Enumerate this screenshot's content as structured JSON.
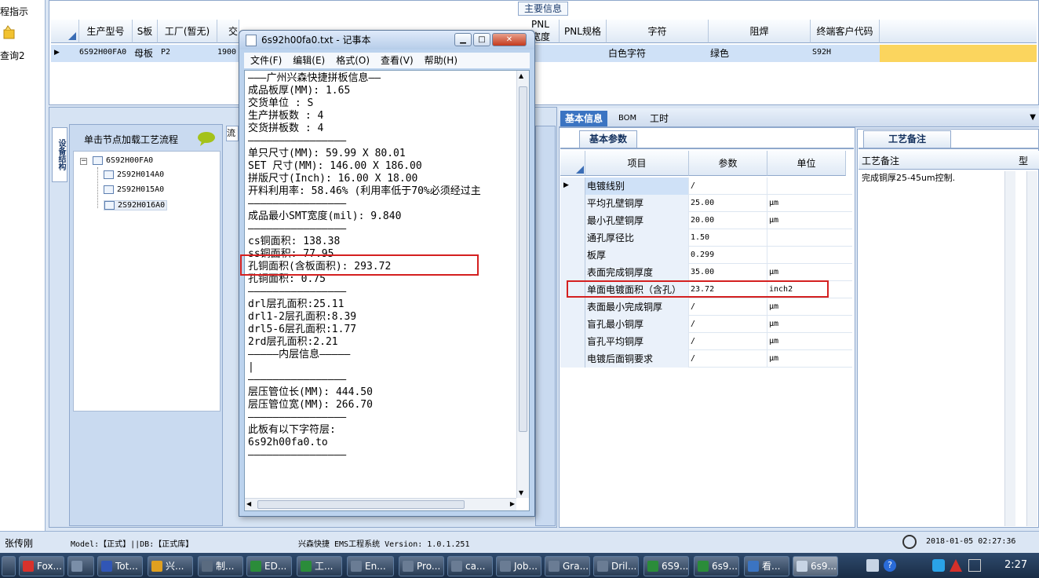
{
  "left_strip": {
    "line1": "程指示",
    "line2": "查询2"
  },
  "top_grid": {
    "tab_caption": "主要信息",
    "headers": [
      "生产型号",
      "S板",
      "工厂(暂无)",
      "交",
      "PNL宽度",
      "PNL规格",
      "字符",
      "阻焊",
      "终端客户代码"
    ],
    "row": {
      "model": "6S92H00FA0",
      "board": "母板",
      "factory": "P2",
      "num": "1900",
      "char": "白色字符",
      "mask": "绿色",
      "cust": "S92H"
    }
  },
  "tree": {
    "title": "单击节点加载工艺流程",
    "side_tab": "设备结构",
    "flow_tab": "流",
    "root": "6S92H00FA0",
    "children": [
      "2S92H014A0",
      "2S92H015A0",
      "2S92H016A0"
    ]
  },
  "notepad": {
    "title": "6s92h00fa0.txt - 记事本",
    "menu": [
      "文件(F)",
      "编辑(E)",
      "格式(O)",
      "查看(V)",
      "帮助(H)"
    ],
    "lines": [
      "———广州兴森快捷拼板信息——",
      "成品板厚(MM): 1.65",
      "交货单位 : S",
      "生产拼板数 : 4",
      "交货拼板数 : 4",
      "————————————————",
      "单只尺寸(MM): 59.99 X 80.01",
      "SET 尺寸(MM): 146.00 X 186.00",
      "拼版尺寸(Inch): 16.00 X 18.00",
      "开料利用率: 58.46% (利用率低于70%必须经过主",
      "————————————————",
      "成品最小SMT宽度(mil): 9.840",
      "————————————————",
      "cs铜面积: 138.38",
      "ss铜面积: 77.95",
      "孔铜面积(含板面积): 293.72",
      "孔铜面积: 0.75",
      "————————————————",
      "drl层孔面积:25.11",
      "drl1-2层孔面积:8.39",
      "drl5-6层孔面积:1.77",
      "2rd层孔面积:2.21",
      "",
      "—————内层信息—————",
      "",
      "|",
      "————————————————",
      "层压管位长(MM): 444.50",
      "层压管位宽(MM): 266.70",
      "————————————————",
      "此板有以下字符层:",
      "6s92h00fa0.to",
      "————————————————"
    ]
  },
  "right_tabs": [
    "基本信息",
    "BOM",
    "工时"
  ],
  "basic": {
    "subtab": "基本参数",
    "headers": [
      "项目",
      "参数",
      "单位"
    ],
    "rows": [
      {
        "item": "电镀线别",
        "param": "/",
        "unit": ""
      },
      {
        "item": "平均孔壁铜厚",
        "param": "25.00",
        "unit": "μm"
      },
      {
        "item": "最小孔壁铜厚",
        "param": "20.00",
        "unit": "μm"
      },
      {
        "item": "通孔厚径比",
        "param": "1.50",
        "unit": ""
      },
      {
        "item": "板厚",
        "param": "0.299",
        "unit": ""
      },
      {
        "item": "表面完成铜厚度",
        "param": "35.00",
        "unit": "μm"
      },
      {
        "item": "单面电镀面积（含孔）",
        "param": "23.72",
        "unit": "inch2"
      },
      {
        "item": "表面最小完成铜厚",
        "param": "/",
        "unit": "μm"
      },
      {
        "item": "盲孔最小铜厚",
        "param": "/",
        "unit": "μm"
      },
      {
        "item": "盲孔平均铜厚",
        "param": "/",
        "unit": "μm"
      },
      {
        "item": "电镀后面铜要求",
        "param": "/",
        "unit": "μm"
      }
    ]
  },
  "remark": {
    "subtab": "工艺备注",
    "header": "工艺备注",
    "header2": "型",
    "text": "完成铜厚25-45um控制."
  },
  "status": {
    "user": "张传刚",
    "model": "Model:【正式】||DB:【正式库】",
    "system": "兴森快捷 EMS工程系统 Version: 1.0.1.251",
    "datetime": "2018-01-05 02:27:36"
  },
  "taskbar": {
    "items": [
      "Fox...",
      "",
      "Tot...",
      "兴...",
      "制...",
      "ED...",
      "工...",
      "En...",
      "Pro...",
      "ca...",
      "Job...",
      "Gra...",
      "Dril...",
      "6S9...",
      "6s9...",
      "看...",
      "6s9..."
    ],
    "clock": "2:27"
  }
}
